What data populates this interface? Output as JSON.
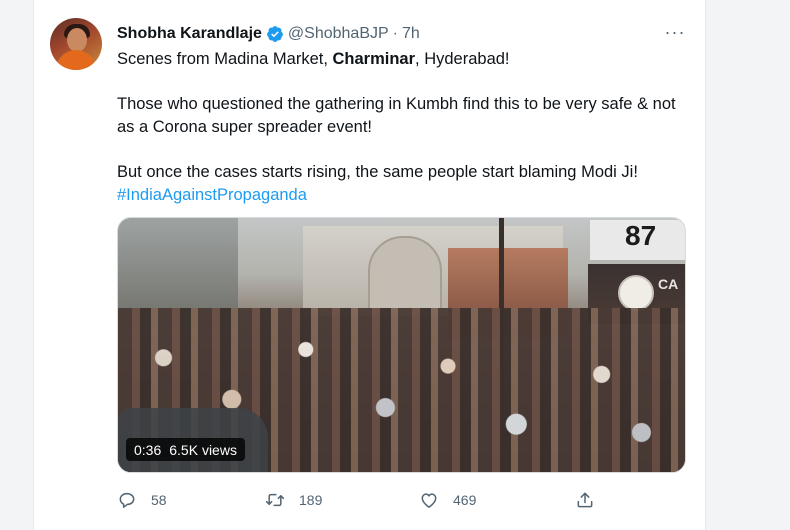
{
  "tweet": {
    "author": {
      "display_name": "Shobha Karandlaje",
      "handle": "@ShobhaBJP",
      "separator": "·",
      "time_ago": "7h",
      "verified": true
    },
    "more_menu_icon": "···",
    "text": {
      "line1_before": "Scenes from Madina Market, ",
      "line1_bold": "Charminar",
      "line1_after": ", Hyderabad!",
      "paragraph2": "Those who questioned the gathering in Kumbh find this to be very safe & not as a Corona super spreader event!",
      "paragraph3": "But once the cases starts rising, the same people start blaming Modi Ji!",
      "hashtag": "#IndiaAgainstPropaganda"
    },
    "media": {
      "duration": "0:36",
      "views": "6.5K views",
      "sign_number": "87",
      "sign_text": "CA"
    },
    "actions": {
      "replies": "58",
      "retweets": "189",
      "likes": "469"
    }
  },
  "icons": [
    "verified-badge-icon",
    "more-options-icon",
    "reply-icon",
    "retweet-icon",
    "like-icon",
    "share-icon"
  ],
  "colors": {
    "accent": "#1d9bf0",
    "text_primary": "#0f1419",
    "text_secondary": "#536471"
  }
}
